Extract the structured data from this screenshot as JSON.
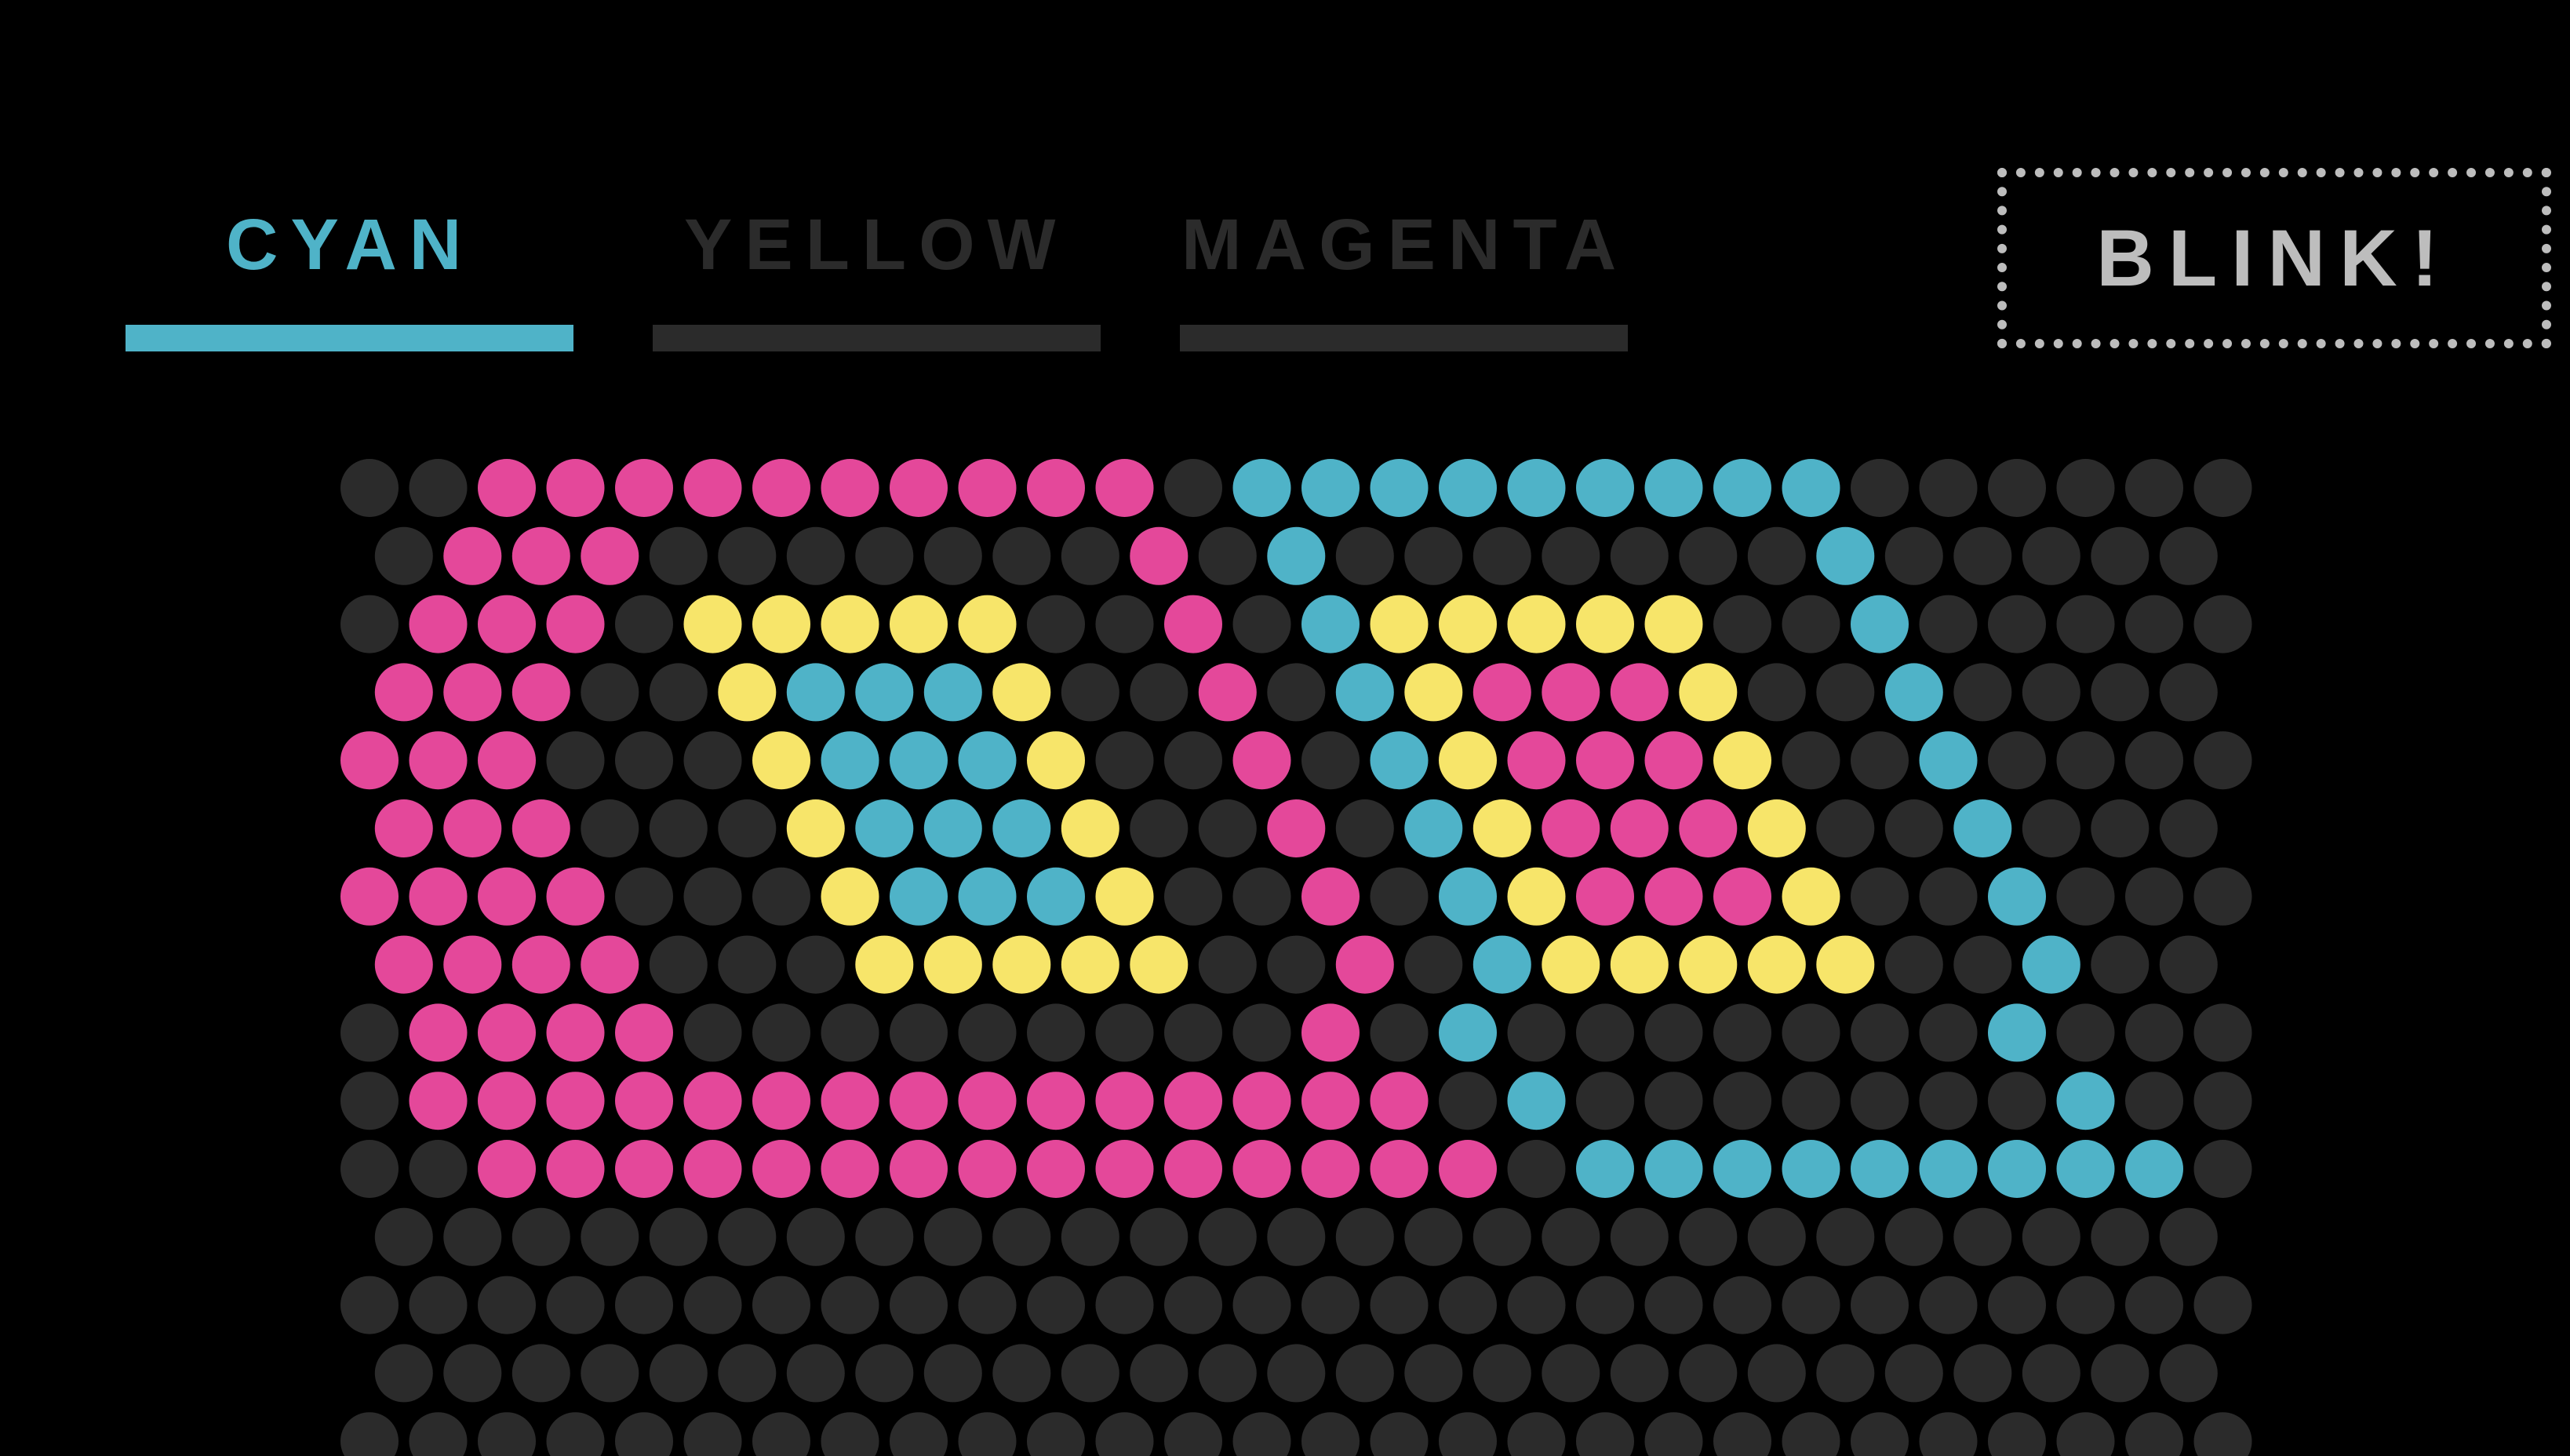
{
  "tabs": [
    {
      "label": "CYAN",
      "active": true
    },
    {
      "label": "YELLOW",
      "active": false
    },
    {
      "label": "MAGENTA",
      "active": false
    }
  ],
  "blink_button": {
    "label": "BLINK!"
  },
  "colors": {
    "background": "#000000",
    "cyan": "#4fb3c8",
    "yellow": "#f7e56a",
    "magenta": "#e4489a",
    "off": "#2b2b2b",
    "inactive_text": "#2b2b2b",
    "button_text": "#bdbdbd"
  },
  "grid": {
    "legend": {
      ".": "off",
      "M": "magenta",
      "C": "cyan",
      "Y": "yellow"
    },
    "rows": [
      "..MMMMMMMMMM.CCCCCCCCC......",
      ".MMM.......M.C.......C.....",
      ".MMM.YYYYY..M.CYYYYY..C.....",
      "MMM..YCCCY..M.CYMMMY..C....",
      "MMM...YCCCY..M.CYMMMY..C....",
      "MMM...YCCCY..M.CYMMMY..C...",
      "MMMM...YCCCY..M.CYMMMY..C...",
      "MMMM...YYYYY..M.CYYYYY..C..",
      ".MMMM.........M.C.......C...",
      ".MMMMMMMMMMMMMMM.C.......C..",
      "..MMMMMMMMMMMMMMM.CCCCCCCCC.",
      "...........................",
      "............................",
      "...........................",
      "............................"
    ]
  }
}
